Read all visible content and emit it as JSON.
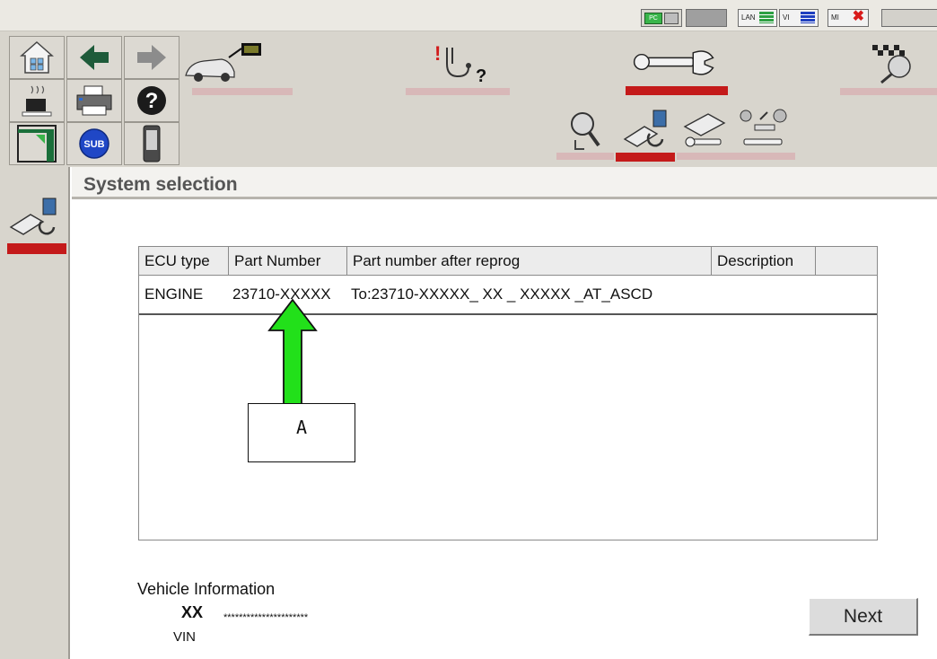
{
  "status_indicators": {
    "pc": "PC",
    "lan": "LAN",
    "vi": "VI",
    "mi": "MI"
  },
  "toolbar": {
    "home_icon": "home-icon",
    "back_icon": "arrow-left-icon",
    "forward_icon": "arrow-right-icon",
    "screen_capture_icon": "cup-icon",
    "print_icon": "printer-icon",
    "help_icon": "help-icon",
    "help_glyph": "?",
    "sub_label": "SUB",
    "mode_tabs": [
      {
        "name": "vehicle-connect",
        "icon": "car-monitor-icon",
        "active": false
      },
      {
        "name": "diagnosis",
        "icon": "stethoscope-icon",
        "glyph_bang": "!",
        "glyph_q": "?",
        "active": false
      },
      {
        "name": "repair",
        "icon": "wrench-icon",
        "active": true
      },
      {
        "name": "race",
        "icon": "checkered-flag-icon",
        "active": false
      }
    ],
    "sub_tabs": [
      {
        "name": "search",
        "icon": "magnifier-icon",
        "active": false
      },
      {
        "name": "reprogramming",
        "icon": "ecu-reprog-icon",
        "active": true
      },
      {
        "name": "ecu-replace",
        "icon": "ecu-wrench-icon",
        "active": false
      },
      {
        "name": "parts",
        "icon": "parts-icon",
        "active": false
      }
    ]
  },
  "page": {
    "title": "System selection"
  },
  "table": {
    "headers": [
      "ECU type",
      "Part Number",
      "Part number after reprog",
      "Description",
      ""
    ],
    "rows": [
      {
        "ecu_type": "ENGINE",
        "part_number": "23710-XXXXX",
        "after_reprog_prefix": "To:23710-",
        "after_reprog_rest": "XXXXX_ XX _ XXXXX",
        "after_reprog_suffix": " _AT_ASCD",
        "description": ""
      }
    ]
  },
  "annotation": {
    "label": "A",
    "arrow_color": "#22e01a"
  },
  "vehicle_info": {
    "heading": "Vehicle Information",
    "model": "XX",
    "vin_value": "**********************",
    "vin_label": "VIN"
  },
  "buttons": {
    "next": "Next"
  },
  "colors": {
    "active_underline": "#c41a1a",
    "inactive_underline": "#d8b8b8",
    "chrome": "#d8d5cd"
  }
}
